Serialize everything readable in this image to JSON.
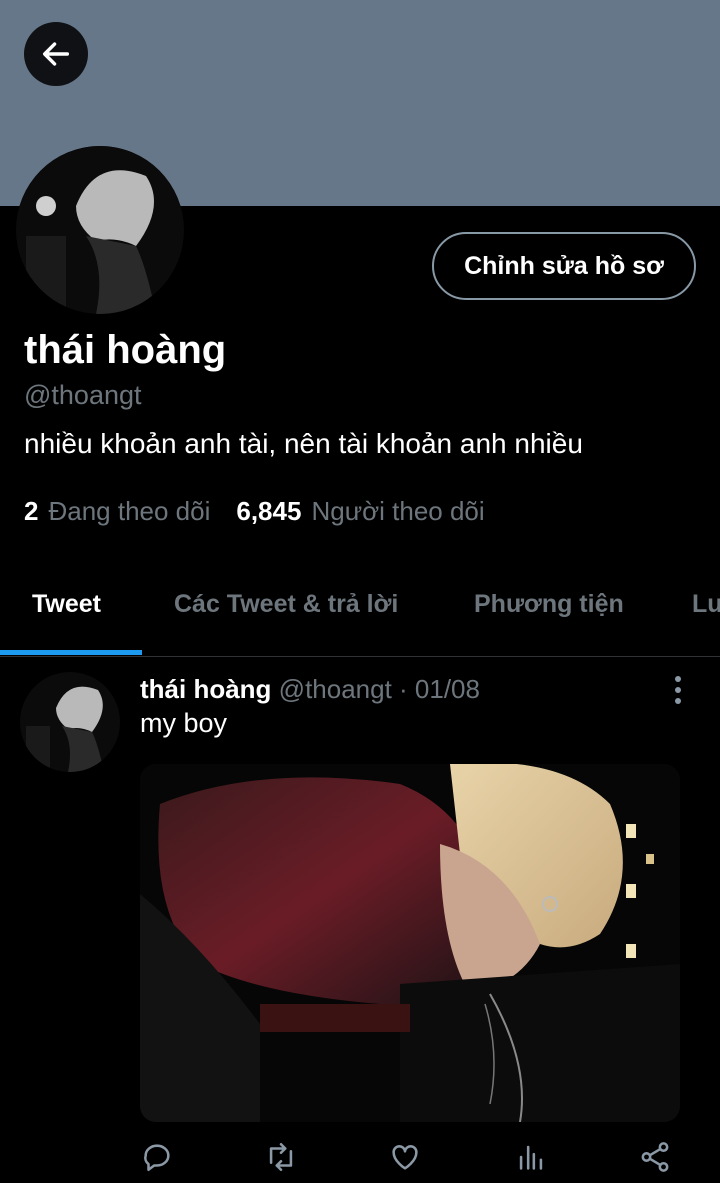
{
  "profile": {
    "edit_label": "Chỉnh sửa hồ sơ",
    "name": "thái hoàng",
    "handle": "@thoangt",
    "bio": "nhiều khoản anh tài, nên tài khoản anh nhiều",
    "following_count": "2",
    "following_label": "Đang theo dõi",
    "followers_count": "6,845",
    "followers_label": "Người theo dõi"
  },
  "tabs": [
    {
      "label": "Tweet",
      "active": true
    },
    {
      "label": "Các Tweet & trả lời",
      "active": false
    },
    {
      "label": "Phương tiện",
      "active": false
    },
    {
      "label": "Lư",
      "active": false
    }
  ],
  "tweet": {
    "name": "thái hoàng",
    "handle_date": "@thoangt · 01/08",
    "text": "my boy"
  },
  "colors": {
    "banner": "#66778a",
    "accent": "#1d9bf0",
    "muted_text": "#6e767d",
    "background": "#000000"
  },
  "icons": [
    "arrow-left-icon",
    "more-vertical-icon",
    "reply-icon",
    "retweet-icon",
    "like-icon",
    "analytics-icon",
    "share-icon"
  ]
}
